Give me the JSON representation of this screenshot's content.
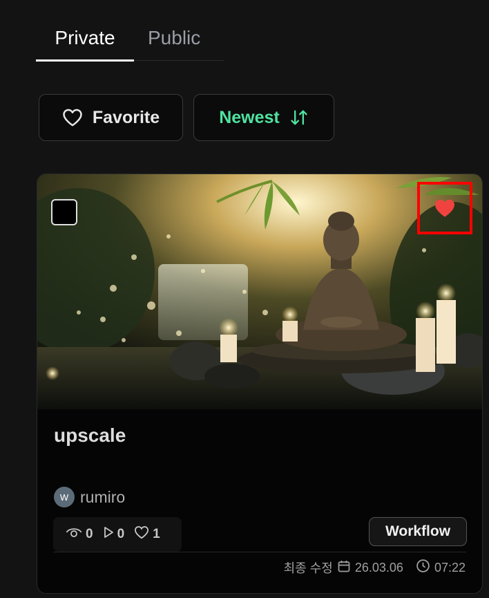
{
  "tabs": {
    "private": "Private",
    "public": "Public",
    "active": "Private"
  },
  "filters": {
    "favorite": "Favorite",
    "sort": "Newest",
    "sort_color": "#4fe3a1"
  },
  "card": {
    "title": "upscale",
    "author": {
      "initial": "W",
      "name": "rumiro"
    },
    "stats": {
      "views": "0",
      "runs": "0",
      "likes": "1"
    },
    "badge": "Workflow",
    "favorited": true,
    "heart_color": "#f0433f",
    "highlight_color": "#ff0000",
    "updated_label": "최종 수정",
    "updated_date": "26.03.06",
    "updated_time": "07:22"
  },
  "icons": {
    "favorite": "heart-outline-icon",
    "sort": "sort-arrows-icon",
    "fav_toggle": "heart-filled-icon",
    "views": "eye-icon",
    "runs": "play-icon",
    "likes": "heart-outline-icon",
    "date": "calendar-icon",
    "time": "clock-icon"
  }
}
